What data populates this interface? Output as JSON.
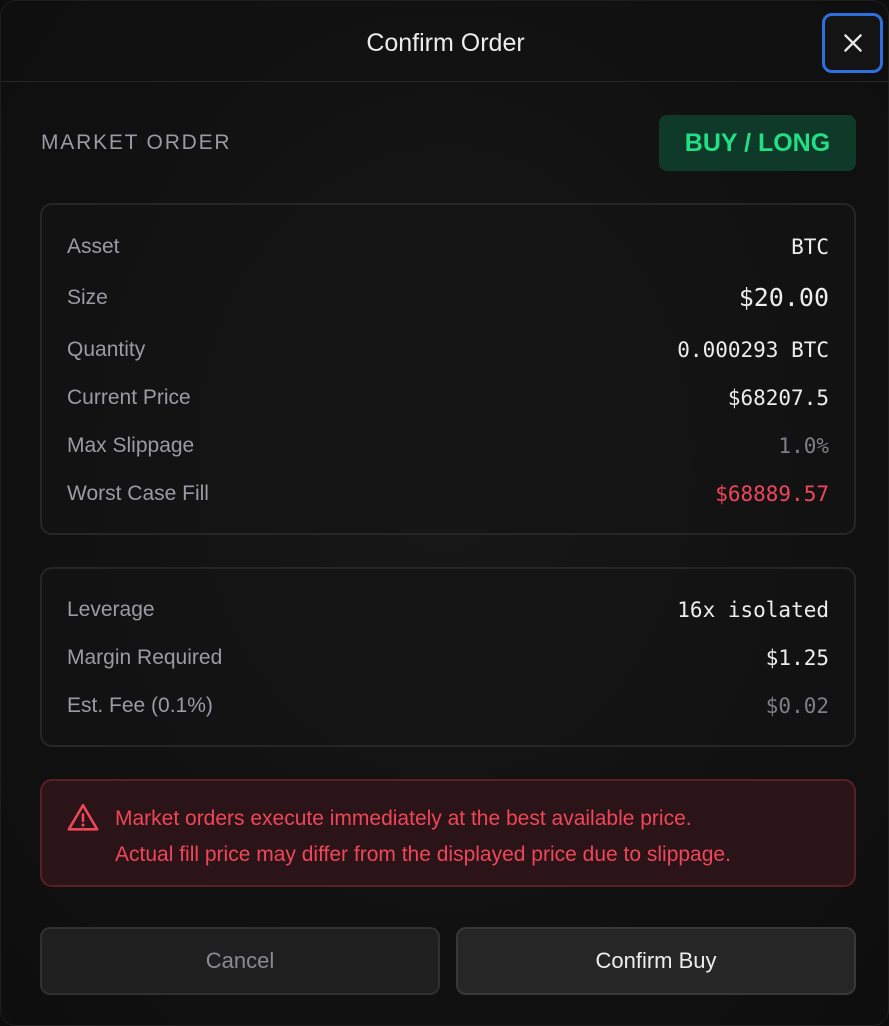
{
  "dialog": {
    "title": "Confirm Order",
    "close_icon": "close-icon"
  },
  "order": {
    "type_label": "MARKET ORDER",
    "side_label": "BUY / LONG",
    "side_color": "#22df84"
  },
  "details": [
    {
      "label": "Asset",
      "value": "BTC"
    },
    {
      "label": "Size",
      "value": "$20.00"
    },
    {
      "label": "Quantity",
      "value": "0.000293 BTC"
    },
    {
      "label": "Current Price",
      "value": "$68207.5"
    },
    {
      "label": "Max Slippage",
      "value": "1.0%"
    },
    {
      "label": "Worst Case Fill",
      "value": "$68889.57"
    }
  ],
  "margin": [
    {
      "label": "Leverage",
      "value": "16x isolated"
    },
    {
      "label": "Margin Required",
      "value": "$1.25"
    },
    {
      "label": "Est. Fee (0.1%)",
      "value": "$0.02"
    }
  ],
  "warning": {
    "icon": "warning-icon",
    "line1": "Market orders execute immediately at the best available price.",
    "line2": "Actual fill price may differ from the displayed price due to slippage.",
    "color": "#f0465a"
  },
  "actions": {
    "cancel_label": "Cancel",
    "confirm_label": "Confirm Buy"
  }
}
